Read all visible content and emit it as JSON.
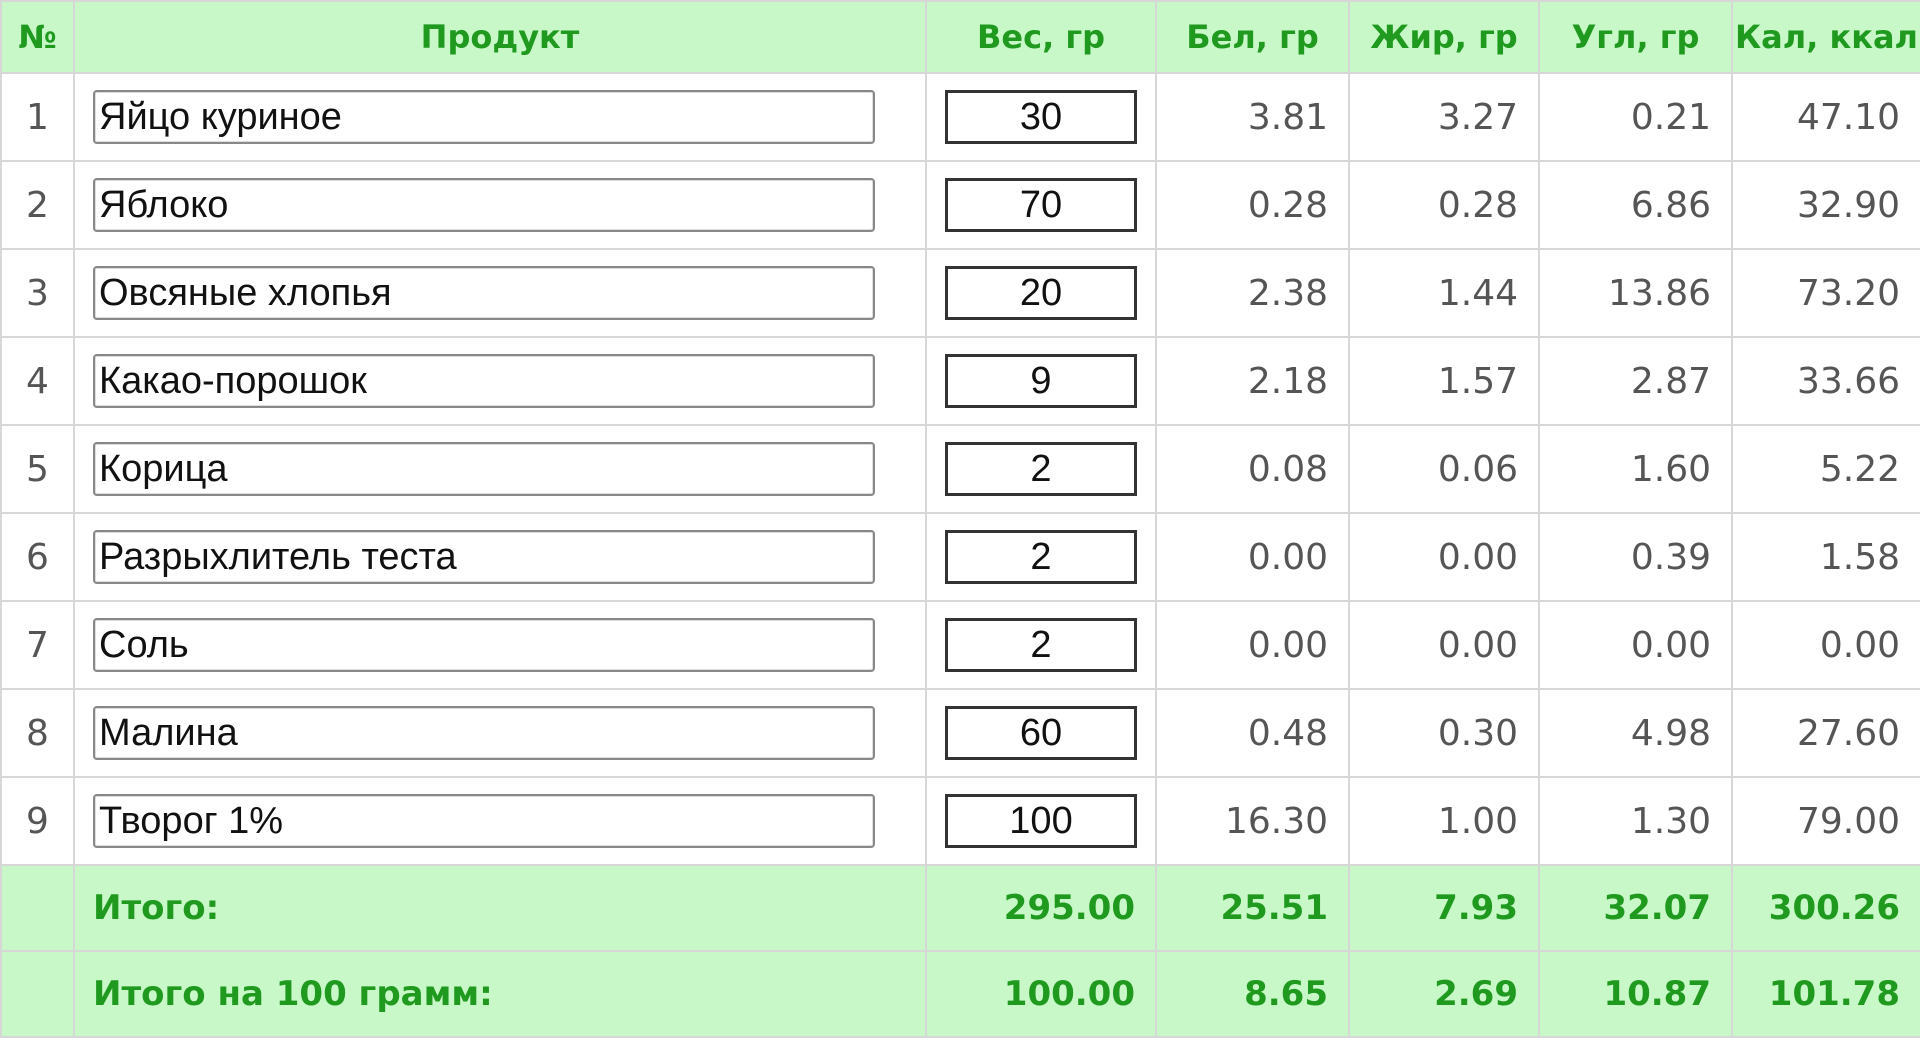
{
  "headers": {
    "num": "№",
    "product": "Продукт",
    "weight": "Вес, гр",
    "protein": "Бел, гр",
    "fat": "Жир, гр",
    "carbs": "Угл, гр",
    "kcal": "Кал, ккал"
  },
  "rows": [
    {
      "num": "1",
      "product": "Яйцо куриное",
      "weight": "30",
      "protein": "3.81",
      "fat": "3.27",
      "carbs": "0.21",
      "kcal": "47.10"
    },
    {
      "num": "2",
      "product": "Яблоко",
      "weight": "70",
      "protein": "0.28",
      "fat": "0.28",
      "carbs": "6.86",
      "kcal": "32.90"
    },
    {
      "num": "3",
      "product": "Овсяные хлопья",
      "weight": "20",
      "protein": "2.38",
      "fat": "1.44",
      "carbs": "13.86",
      "kcal": "73.20"
    },
    {
      "num": "4",
      "product": "Какао-порошок",
      "weight": "9",
      "protein": "2.18",
      "fat": "1.57",
      "carbs": "2.87",
      "kcal": "33.66"
    },
    {
      "num": "5",
      "product": "Корица",
      "weight": "2",
      "protein": "0.08",
      "fat": "0.06",
      "carbs": "1.60",
      "kcal": "5.22"
    },
    {
      "num": "6",
      "product": "Разрыхлитель теста",
      "weight": "2",
      "protein": "0.00",
      "fat": "0.00",
      "carbs": "0.39",
      "kcal": "1.58"
    },
    {
      "num": "7",
      "product": "Соль",
      "weight": "2",
      "protein": "0.00",
      "fat": "0.00",
      "carbs": "0.00",
      "kcal": "0.00"
    },
    {
      "num": "8",
      "product": "Малина",
      "weight": "60",
      "protein": "0.48",
      "fat": "0.30",
      "carbs": "4.98",
      "kcal": "27.60"
    },
    {
      "num": "9",
      "product": "Творог 1%",
      "weight": "100",
      "protein": "16.30",
      "fat": "1.00",
      "carbs": "1.30",
      "kcal": "79.00"
    }
  ],
  "totals": {
    "label": "Итого:",
    "weight": "295.00",
    "protein": "25.51",
    "fat": "7.93",
    "carbs": "32.07",
    "kcal": "300.26"
  },
  "per100": {
    "label": "Итого на 100 грамм:",
    "weight": "100.00",
    "protein": "8.65",
    "fat": "2.69",
    "carbs": "10.87",
    "kcal": "101.78"
  },
  "colors": {
    "header_bg": "#c8f7c8",
    "header_text": "#1f9a1f",
    "value_text": "#555555",
    "border": "#d7d7d7"
  }
}
